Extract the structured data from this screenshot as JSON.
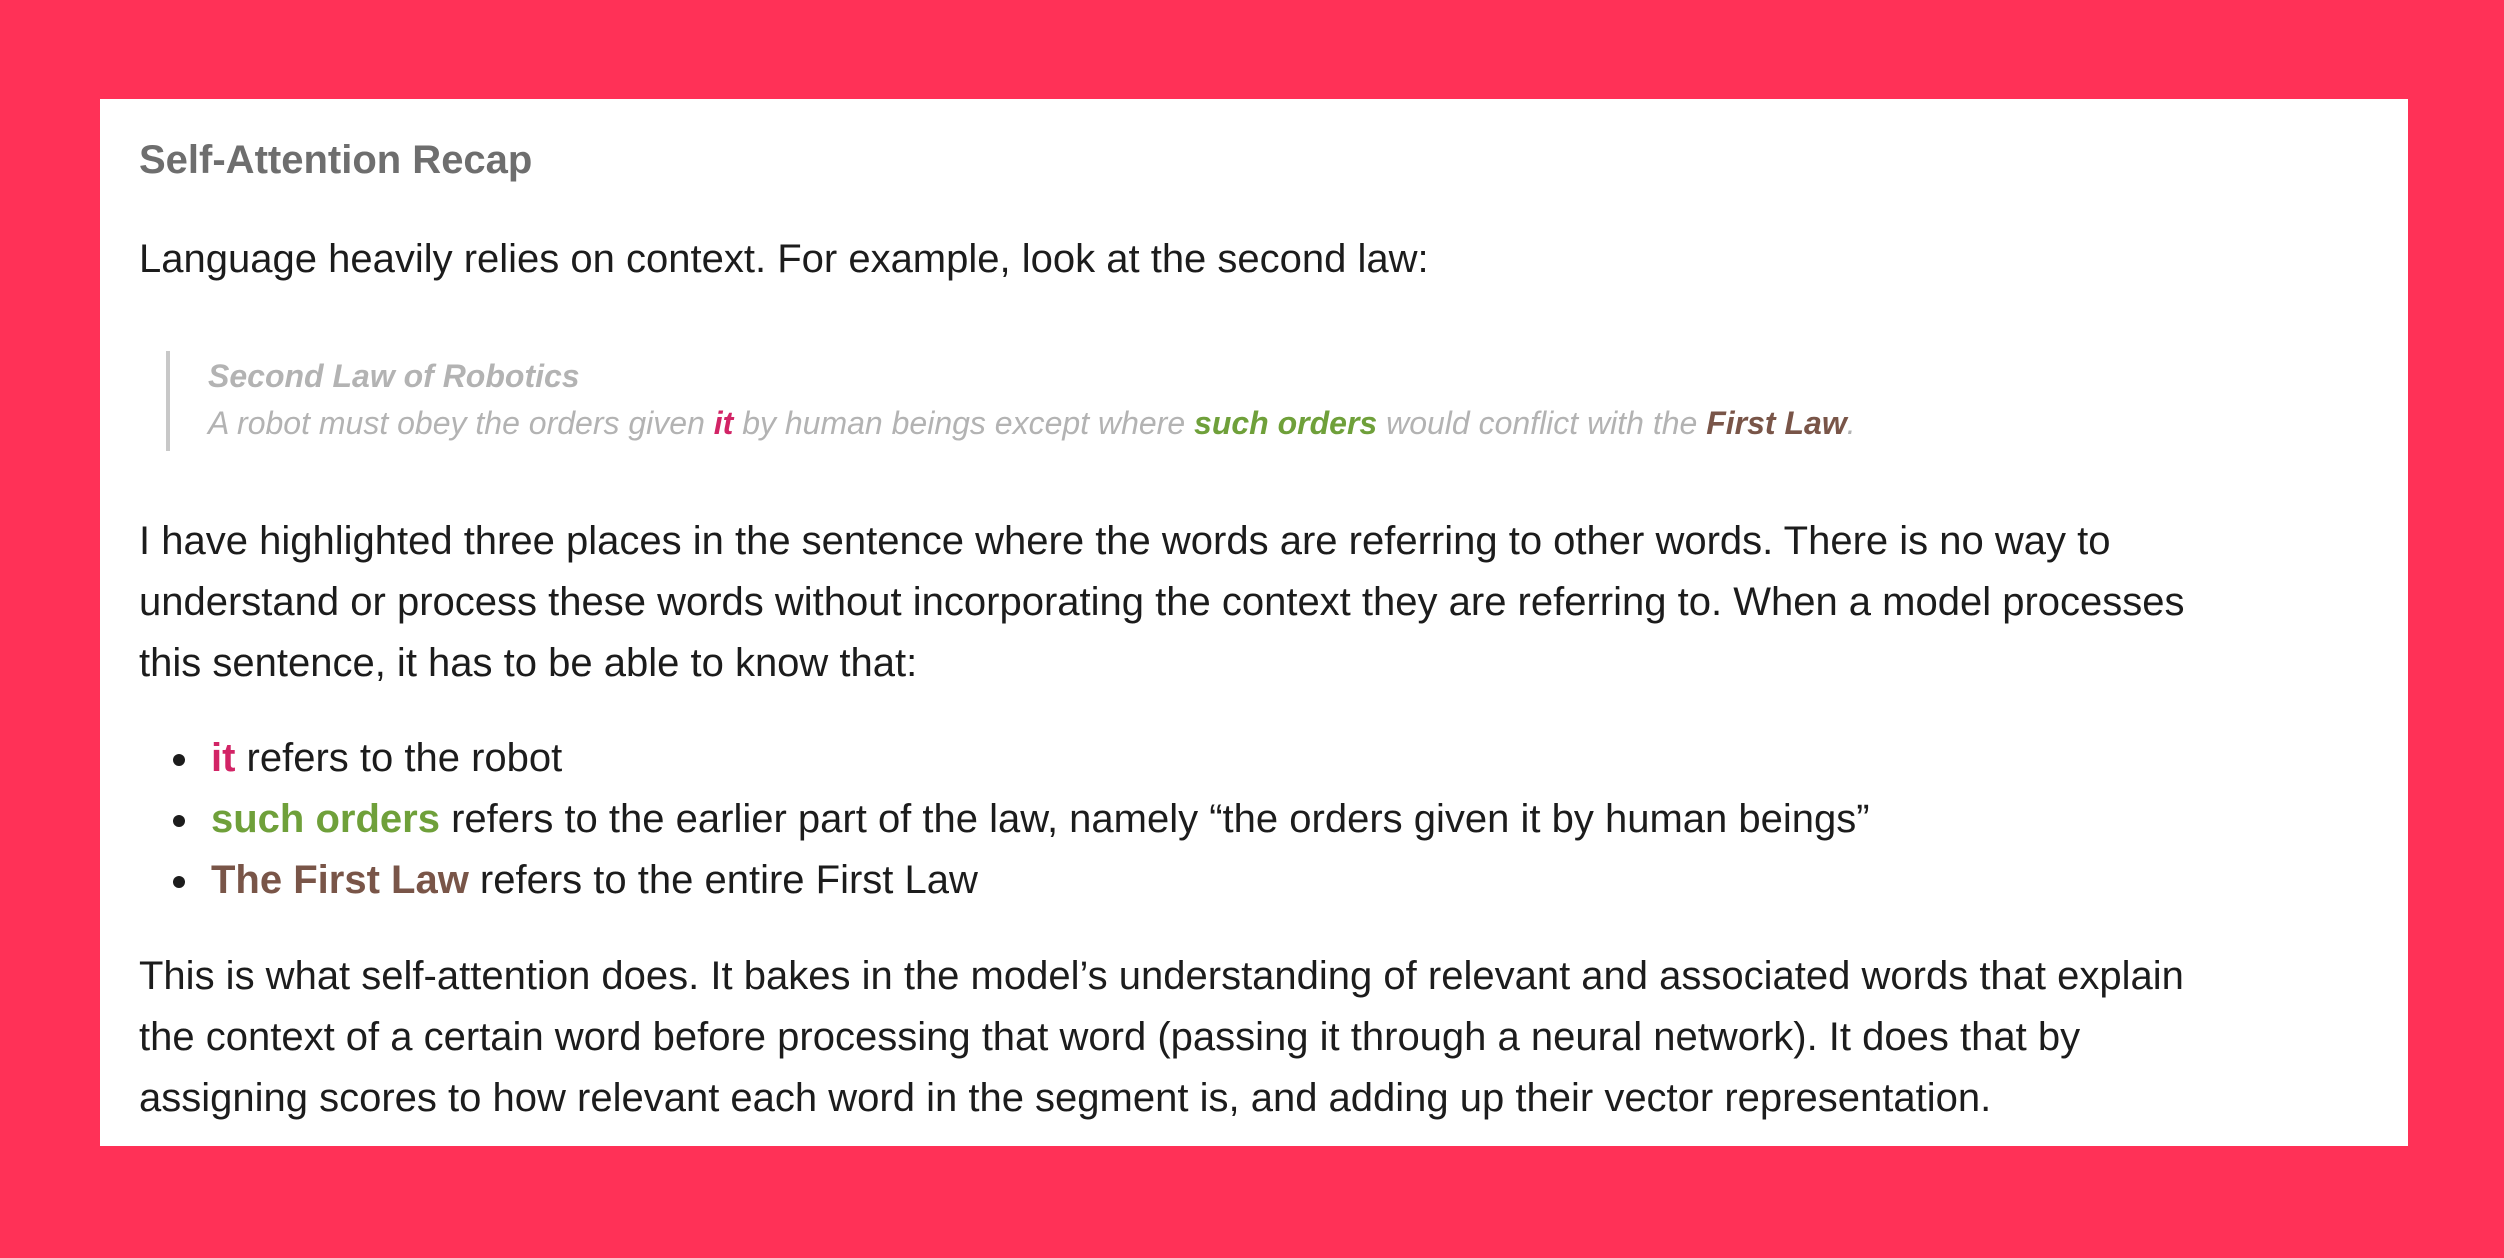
{
  "heading": "Self-Attention Recap",
  "intro": "Language heavily relies on context. For example, look at the second law:",
  "quote": {
    "title": "Second Law of Robotics",
    "part1": "A robot must obey the orders given ",
    "hl1": "it",
    "part2": " by human beings except where ",
    "hl2": "such orders",
    "part3": " would conflict with the ",
    "hl3": "First Law",
    "part4": "."
  },
  "para1": {
    "line1": "I have highlighted three places in the sentence where the words are referring to other words. There is no way to",
    "line2": "understand or process these words without incorporating the context they are referring to. When a model processes",
    "line3": "this sentence, it has to be able to know that:"
  },
  "refs": [
    {
      "term": "it",
      "rest": " refers to the robot"
    },
    {
      "term": "such orders",
      "rest": " refers to the earlier part of the law, namely “the orders given it by human beings”"
    },
    {
      "term": "The First Law",
      "rest": " refers to the entire First Law"
    }
  ],
  "para2": {
    "line1": "This is what self-attention does. It bakes in the model’s understanding of relevant and associated words that explain",
    "line2": "the context of a certain word before processing that word (passing it through a neural network). It does that by",
    "line3": "assigning scores to how relevant each word in the segment is, and adding up their vector representation."
  },
  "colors": {
    "background": "#ff3157",
    "it": "#d22466",
    "such_orders": "#6fa03a",
    "first_law": "#795548"
  }
}
